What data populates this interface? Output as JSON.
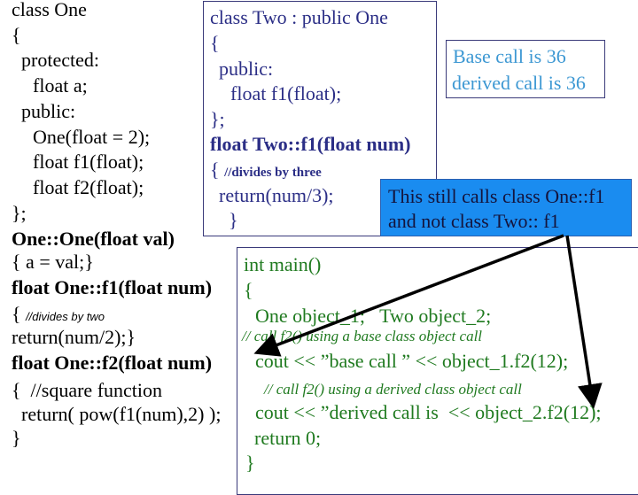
{
  "class_one": {
    "lines": [
      "class One",
      "{",
      "protected:",
      "float a;",
      "public:",
      "One(float = 2);",
      "float f1(float);",
      "float f2(float);",
      "};",
      "One::One(float val)",
      "{ a = val;}",
      "float One::f1(float num)",
      "{ ",
      "return(num/2);}",
      "float One::f2(float num)",
      "{  //square function",
      "return( pow(f1(num),2) );",
      "}"
    ],
    "f1_comment": "//divides by two"
  },
  "class_two": {
    "lines": [
      "class Two : public One",
      "{",
      "public:",
      "float f1(float);",
      "};",
      "float Two::f1(float num)",
      "{ ",
      "return(num/3);",
      "}"
    ],
    "f1_comment": "//divides by three"
  },
  "output_box": {
    "lines": [
      "Base call is 36",
      "derived call is 36"
    ]
  },
  "callout": {
    "lines": [
      "This still calls class One::f1",
      "and not class Two:: f1"
    ]
  },
  "main": {
    "lines": [
      "int main()",
      "{",
      "One object_1;   Two object_2;",
      "// call f2() using a base class object call",
      "cout << ”base call ” << object_1.f2(12);",
      "// call f2() using a derived class object call",
      "cout << ”derived call is  << object_2.f2(12);",
      "return 0;",
      "}"
    ]
  },
  "colors": {
    "class_one_text": "#000000",
    "class_two_text": "#2b2e86",
    "main_text": "#1f7a1f",
    "output_text": "#3d98d3",
    "callout_fill": "#1a8cf0",
    "callout_text": "#14143c",
    "arrow": "#000000"
  }
}
